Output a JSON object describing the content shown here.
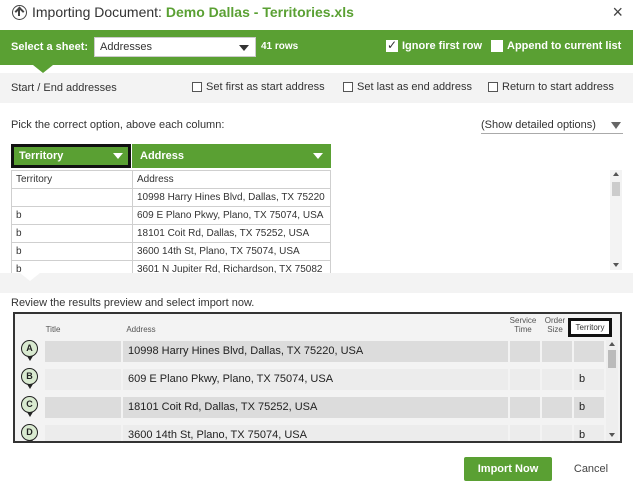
{
  "dialog": {
    "title_prefix": "Importing Document:",
    "file_name": "Demo Dallas - Territories.xls",
    "close_glyph": "×"
  },
  "sheet": {
    "label": "Select a sheet:",
    "selected": "Addresses",
    "row_count": "41 rows",
    "ignore_first_row_label": "Ignore first row",
    "ignore_first_row_checked": true,
    "append_label": "Append to current list",
    "append_checked": false
  },
  "start_end": {
    "label": "Start / End addresses",
    "options": [
      {
        "label": "Set first as start address",
        "checked": false
      },
      {
        "label": "Set last as end address",
        "checked": false
      },
      {
        "label": "Return to start address",
        "checked": false
      }
    ]
  },
  "mapping": {
    "instruction": "Pick the correct option, above each column:",
    "detail_toggle": "(Show detailed options)",
    "columns": [
      {
        "selected": "Territory"
      },
      {
        "selected": "Address"
      }
    ],
    "rows": [
      [
        "Territory",
        "Address"
      ],
      [
        "",
        "10998 Harry Hines Blvd, Dallas, TX 75220"
      ],
      [
        "b",
        "609 E Plano Pkwy, Plano, TX 75074, USA"
      ],
      [
        "b",
        "18101 Coit Rd, Dallas, TX 75252, USA"
      ],
      [
        "b",
        "3600 14th St, Plano, TX 75074, USA"
      ],
      [
        "b",
        "3601 N Jupiter Rd, Richardson, TX 75082"
      ]
    ]
  },
  "preview": {
    "instruction": "Review the results preview and select import now.",
    "headers": {
      "title": "Title",
      "address": "Address",
      "service_time": "Service Time",
      "order_size": "Order Size",
      "territory": "Territory"
    },
    "rows": [
      {
        "pin": "A",
        "title": "",
        "address": "10998 Harry Hines Blvd, Dallas, TX 75220, USA",
        "territory": ""
      },
      {
        "pin": "B",
        "title": "",
        "address": "609 E Plano Pkwy, Plano, TX 75074, USA",
        "territory": "b"
      },
      {
        "pin": "C",
        "title": "",
        "address": "18101 Coit Rd, Dallas, TX 75252, USA",
        "territory": "b"
      },
      {
        "pin": "D",
        "title": "",
        "address": "3600 14th St, Plano, TX 75074, USA",
        "territory": "b"
      }
    ]
  },
  "actions": {
    "import_label": "Import Now",
    "cancel_label": "Cancel"
  },
  "colors": {
    "accent": "#5aa033"
  }
}
